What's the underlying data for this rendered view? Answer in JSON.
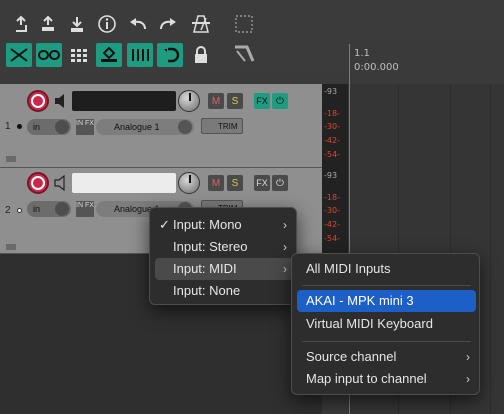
{
  "toolbar": {
    "icons": [
      "new-project-icon",
      "open-project-icon",
      "save-project-icon",
      "project-settings-icon",
      "undo-icon",
      "redo-icon",
      "metronome-icon",
      "grid-icon",
      "auto-crossfade-icon",
      "ripple-edit-icon",
      "snap-grid-icon",
      "item-grouping-icon",
      "snap-icon",
      "loop-icon",
      "lock-icon",
      "envelope-icon"
    ]
  },
  "timeline": {
    "marker": "1.1",
    "time": "0:00.000"
  },
  "tracks": [
    {
      "number": "1",
      "input_mode": "in",
      "input_fx": "IN FX",
      "input_name": "Analogue 1",
      "mute": "M",
      "solo": "S",
      "fx": "FX",
      "trim": "TRIM"
    },
    {
      "number": "2",
      "input_mode": "in",
      "input_fx": "IN FX",
      "input_name": "Analogue 1",
      "mute": "M",
      "solo": "S",
      "fx": "FX",
      "trim": "TRIM"
    }
  ],
  "meter_scale": [
    "-93",
    "-18-",
    "-30-",
    "-42-",
    "-54-"
  ],
  "input_menu": {
    "items": [
      {
        "label": "Input: Mono",
        "checked": true,
        "submenu": true
      },
      {
        "label": "Input: Stereo",
        "checked": false,
        "submenu": true
      },
      {
        "label": "Input: MIDI",
        "checked": false,
        "submenu": true,
        "highlighted": true
      },
      {
        "label": "Input: None",
        "checked": false,
        "submenu": false
      }
    ],
    "check_glyph": "✓",
    "arrow_glyph": "›"
  },
  "midi_submenu": {
    "items": [
      {
        "label": "All MIDI Inputs"
      },
      {
        "label": "AKAI - MPK mini 3",
        "selected": true
      },
      {
        "label": "Virtual MIDI Keyboard"
      },
      {
        "label": "Source channel",
        "submenu": true
      },
      {
        "label": "Map input to channel",
        "submenu": true
      }
    ]
  },
  "colors": {
    "accent": "#1d9c82",
    "record": "#c8294a",
    "selection": "#1c5fc7",
    "meter_red": "#e0452f"
  }
}
